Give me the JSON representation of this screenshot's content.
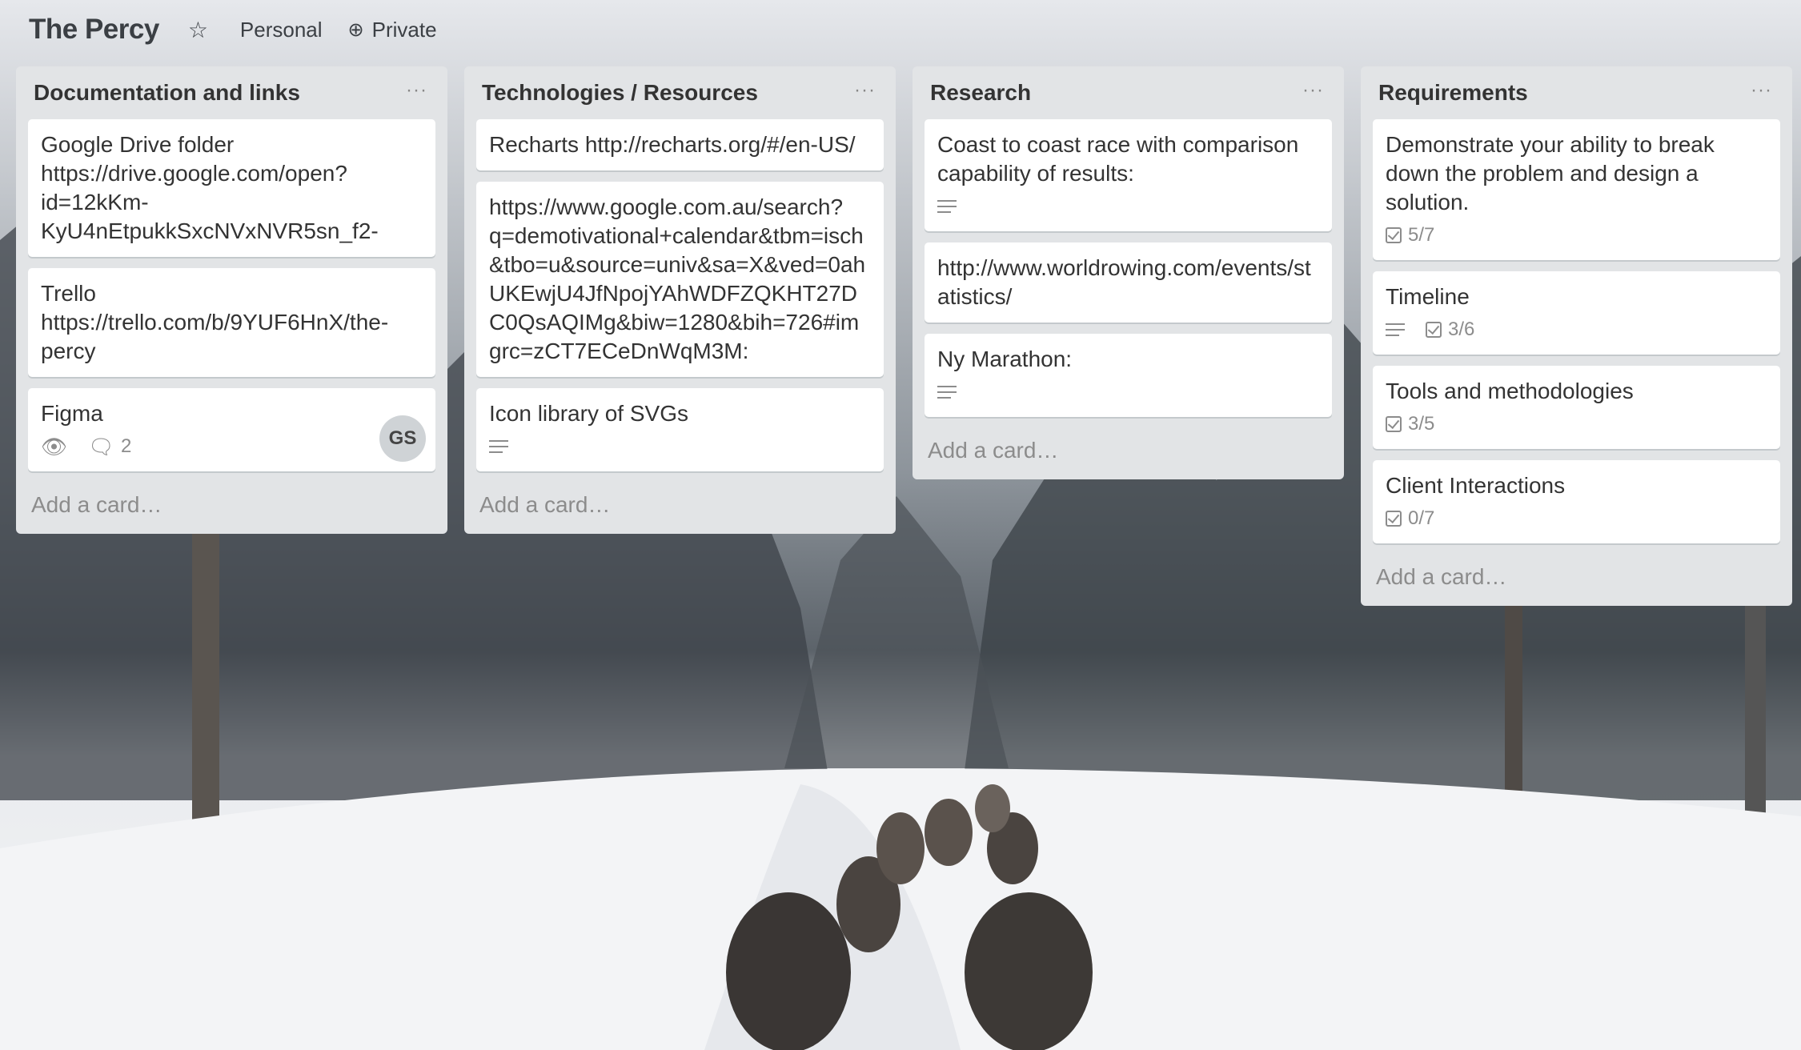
{
  "board": {
    "title": "The Percy",
    "star_icon": "star-icon",
    "team_label": "Personal",
    "visibility_label": "Private"
  },
  "lists": [
    {
      "title": "Documentation and links",
      "menu": "···",
      "add_card": "Add a card…",
      "cards": [
        {
          "text": "Google Drive folder https://drive.google.com/open?id=12kKm-KyU4nEtpukkSxcNVxNVR5sn_f2-"
        },
        {
          "text": "Trello https://trello.com/b/9YUF6HnX/the-percy"
        },
        {
          "text": "Figma",
          "comments": "2",
          "avatar": "GS"
        }
      ]
    },
    {
      "title": "Technologies / Resources",
      "menu": "···",
      "add_card": "Add a card…",
      "cards": [
        {
          "text": "Recharts http://recharts.org/#/en-US/"
        },
        {
          "text": "https://www.google.com.au/search?q=demotivational+calendar&tbm=isch&tbo=u&source=univ&sa=X&ved=0ahUKEwjU4JfNpojYAhWDFZQKHT27DC0QsAQIMg&biw=1280&bih=726#imgrc=zCT7ECeDnWqM3M:"
        },
        {
          "text": "Icon library of SVGs"
        }
      ]
    },
    {
      "title": "Research",
      "menu": "···",
      "add_card": "Add a card…",
      "cards": [
        {
          "text": "Coast to coast race with comparison capability of results:"
        },
        {
          "text": "http://www.worldrowing.com/events/statistics/"
        },
        {
          "text": "Ny Marathon:"
        }
      ]
    },
    {
      "title": "Requirements",
      "menu": "···",
      "add_card": "Add a card…",
      "cards": [
        {
          "text": "Demonstrate your ability to break down the problem and design a solution.",
          "checklist": "5/7"
        },
        {
          "text": "Timeline",
          "checklist": "3/6"
        },
        {
          "text": "Tools and methodologies",
          "checklist": "3/5"
        },
        {
          "text": "Client Interactions",
          "checklist": "0/7"
        }
      ]
    }
  ],
  "colors": {
    "list_bg": "#e2e4e6",
    "card_bg": "#ffffff",
    "text": "#333333",
    "muted": "#8c8c8c"
  }
}
